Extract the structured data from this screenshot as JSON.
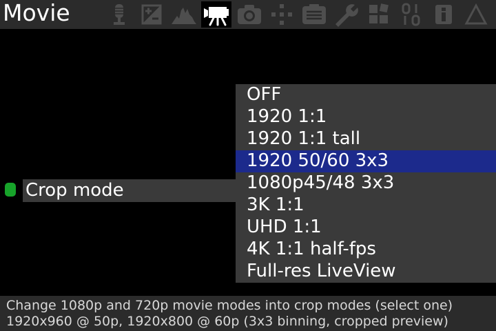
{
  "menu": {
    "title": "Movie",
    "tabs": [
      {
        "name": "audio",
        "icon": "microphone-icon",
        "active": false
      },
      {
        "name": "expo",
        "icon": "exposure-icon",
        "active": false
      },
      {
        "name": "overlay",
        "icon": "histogram-icon",
        "active": false
      },
      {
        "name": "movie",
        "icon": "movie-camera-icon",
        "active": true
      },
      {
        "name": "shoot",
        "icon": "camera-icon",
        "active": false
      },
      {
        "name": "focus",
        "icon": "focus-icon",
        "active": false
      },
      {
        "name": "display",
        "icon": "display-icon",
        "active": false
      },
      {
        "name": "prefs",
        "icon": "wrench-icon",
        "active": false
      },
      {
        "name": "modules",
        "icon": "modules-icon",
        "active": false
      },
      {
        "name": "debug",
        "icon": "binary-icon",
        "active": false
      },
      {
        "name": "help",
        "icon": "info-icon",
        "active": false
      },
      {
        "name": "triangle",
        "icon": "triangle-icon",
        "active": false
      }
    ]
  },
  "item": {
    "label": "Crop mode",
    "status_color": "#17a32a"
  },
  "choices": {
    "options": [
      "OFF",
      "1920 1:1",
      "1920 1:1 tall",
      "1920 50/60 3x3",
      "1080p45/48 3x3",
      "3K 1:1",
      "UHD 1:1",
      "4K 1:1 half-fps",
      "Full-res LiveView"
    ],
    "selected": "1920 50/60 3x3",
    "highlight_color": "#1c2a8c"
  },
  "help": {
    "line1": "Change 1080p and 720p movie modes into crop modes (select one)",
    "line2": "1920x960 @ 50p, 1920x800 @ 60p (3x3 binning, cropped preview)"
  }
}
